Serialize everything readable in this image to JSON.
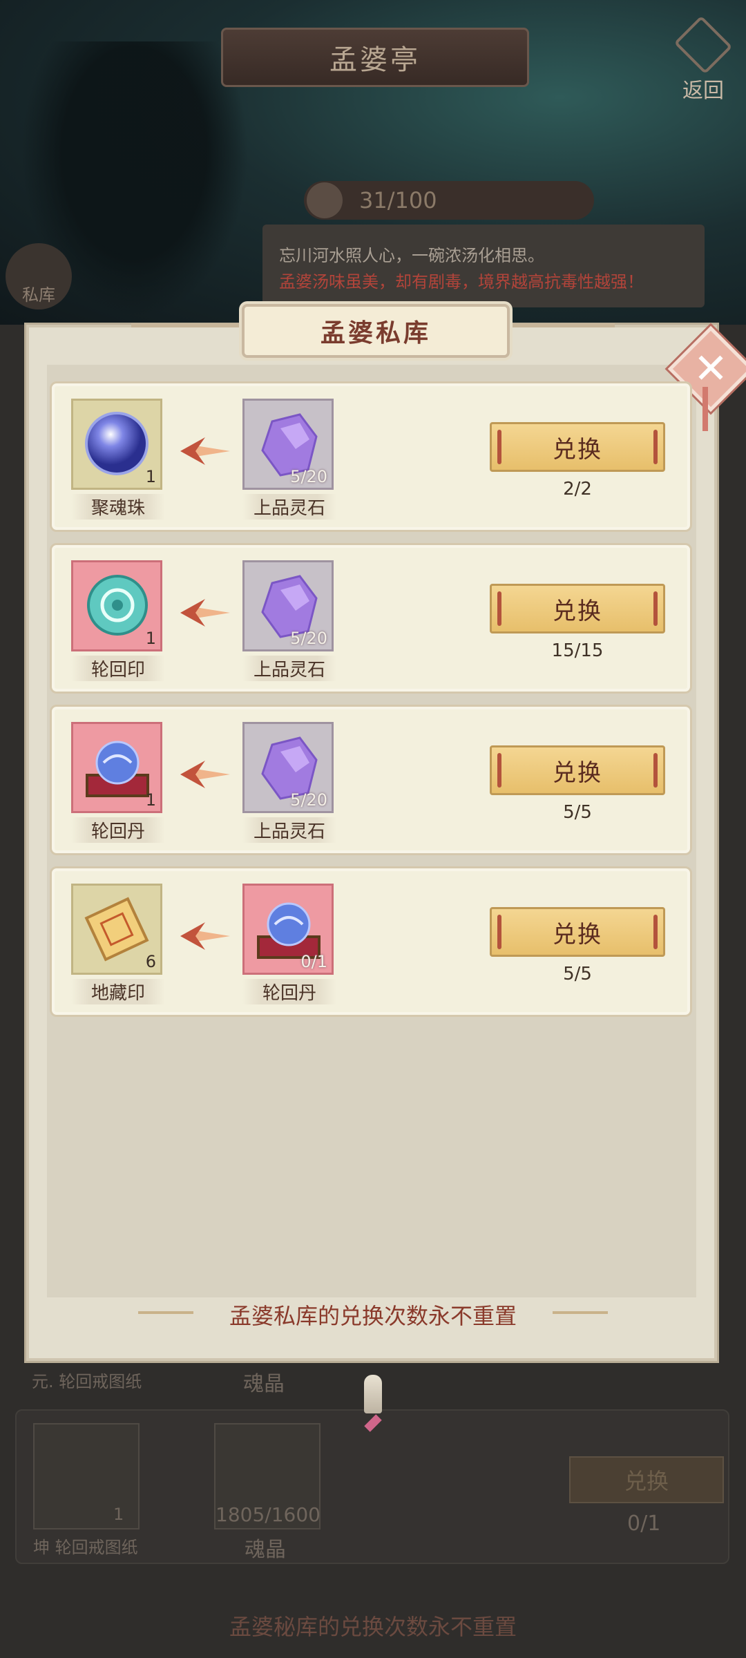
{
  "header": {
    "title": "孟婆亭",
    "back_label": "返回",
    "soup_counter": "31/100",
    "speech_line1": "忘川河水照人心，一碗浓汤化相思。",
    "speech_line2": "孟婆汤味虽美，却有剧毒，境界越高抗毒性越强！",
    "stash_label": "私库"
  },
  "background_rows": {
    "row1_partial_items": [
      "元. 轮回戒图纸",
      "魂晶"
    ],
    "row2": {
      "item_left": "坤 轮回戒图纸",
      "item_left_count": "1",
      "item_right": "魂晶",
      "item_right_count": "1805/1600",
      "button": "兑换",
      "limit": "0/1"
    },
    "footer_note": "孟婆秘库的兑换次数永不重置"
  },
  "modal": {
    "title": "孟婆私库",
    "close_icon": "close-icon",
    "footer_note": "孟婆私库的兑换次数永不重置",
    "rows": [
      {
        "reward": {
          "name": "聚魂珠",
          "count": "1",
          "icon": "soul-orb-icon",
          "bg": "gold"
        },
        "cost": {
          "name": "上品灵石",
          "count": "5/20",
          "icon": "spirit-stone-icon",
          "bg": "purple"
        },
        "button": "兑换",
        "limit": "2/2"
      },
      {
        "reward": {
          "name": "轮回印",
          "count": "1",
          "icon": "reincarnation-seal-icon",
          "bg": "red"
        },
        "cost": {
          "name": "上品灵石",
          "count": "5/20",
          "icon": "spirit-stone-icon",
          "bg": "purple"
        },
        "button": "兑换",
        "limit": "15/15"
      },
      {
        "reward": {
          "name": "轮回丹",
          "count": "1",
          "icon": "reincarnation-pill-icon",
          "bg": "red"
        },
        "cost": {
          "name": "上品灵石",
          "count": "5/20",
          "icon": "spirit-stone-icon",
          "bg": "purple"
        },
        "button": "兑换",
        "limit": "5/5"
      },
      {
        "reward": {
          "name": "地藏印",
          "count": "6",
          "icon": "dizang-seal-icon",
          "bg": "gold"
        },
        "cost": {
          "name": "轮回丹",
          "count": "0/1",
          "icon": "reincarnation-pill-icon",
          "bg": "red"
        },
        "button": "兑换",
        "limit": "5/5"
      }
    ]
  }
}
